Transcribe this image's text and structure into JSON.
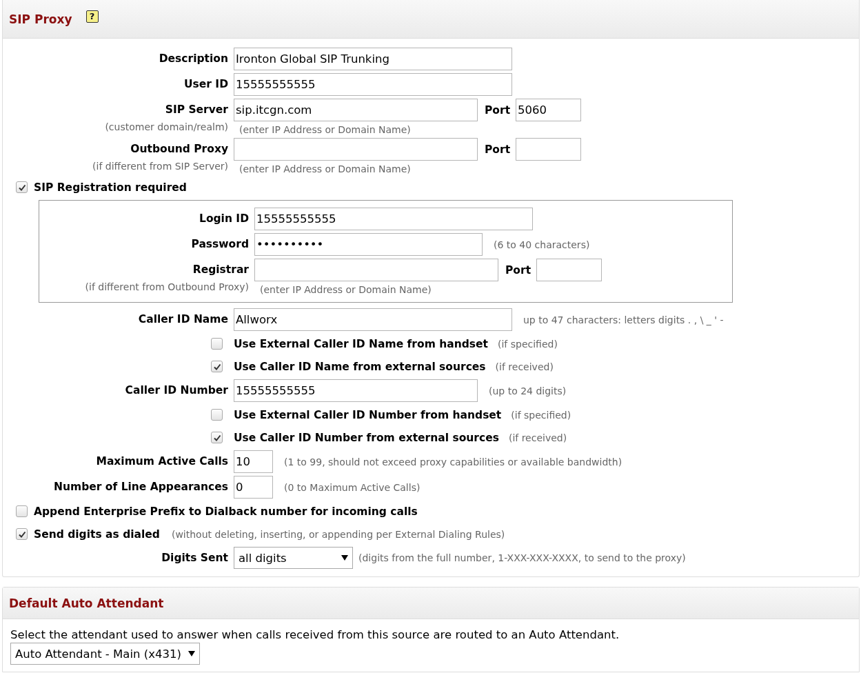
{
  "sections": [
    {
      "title": "SIP Proxy",
      "help": "?",
      "rows": [
        {
          "kind": "field",
          "label": "Description",
          "value": "Ironton Global SIP Trunking"
        },
        {
          "kind": "field",
          "label": "User ID",
          "value": "15555555555"
        },
        {
          "kind": "field",
          "label": "SIP Server",
          "sublabel": "(customer domain/realm)",
          "value": "sip.itcgn.com",
          "port": {
            "label": "Port",
            "value": "5060"
          },
          "hint": "(enter IP Address or Domain Name)"
        },
        {
          "kind": "field",
          "label": "Outbound Proxy",
          "sublabel": "(if different from SIP Server)",
          "port": {
            "label": "Port"
          },
          "hint": "(enter IP Address or Domain Name)"
        },
        {
          "kind": "check",
          "label": "SIP Registration required",
          "checked": true
        },
        {
          "kind": "group",
          "rows": [
            {
              "kind": "field",
              "label": "Login ID",
              "value": "15555555555"
            },
            {
              "kind": "field",
              "label": "Password",
              "value": "••••••••••",
              "note": "(6 to 40 characters)"
            },
            {
              "kind": "field",
              "label": "Registrar",
              "sublabel": "(if different from Outbound Proxy)",
              "port": {
                "label": "Port"
              },
              "hint": "(enter IP Address or Domain Name)"
            }
          ]
        },
        {
          "kind": "field",
          "label": "Caller ID Name",
          "value": "Allworx",
          "note": "up to 47 characters: letters digits . , \\ _ ' -"
        },
        {
          "kind": "option",
          "label": "Use External Caller ID Name from handset",
          "note": "(if specified)",
          "checked": false
        },
        {
          "kind": "option",
          "label": "Use Caller ID Name from external sources",
          "note": "(if received)",
          "checked": true
        },
        {
          "kind": "field",
          "label": "Caller ID Number",
          "value": "15555555555",
          "note": "(up to 24 digits)"
        },
        {
          "kind": "option",
          "label": "Use External Caller ID Number from handset",
          "note": "(if specified)",
          "checked": false
        },
        {
          "kind": "option",
          "label": "Use Caller ID Number from external sources",
          "note": "(if received)",
          "checked": true
        },
        {
          "kind": "field",
          "label": "Maximum Active Calls",
          "value": "10",
          "note": "(1 to 99, should not exceed proxy capabilities or available bandwidth)"
        },
        {
          "kind": "field",
          "label": "Number of Line Appearances",
          "value": "0",
          "note": "(0 to Maximum Active Calls)"
        },
        {
          "kind": "check",
          "label": "Append Enterprise Prefix to Dialback number for incoming calls",
          "checked": false
        },
        {
          "kind": "check",
          "label": "Send digits as dialed",
          "note": "(without deleting, inserting, or appending per External Dialing Rules)",
          "checked": true
        },
        {
          "kind": "select",
          "label": "Digits Sent",
          "value": "all digits",
          "note": "(digits from the full number, 1-XXX-XXX-XXXX, to send to the proxy)"
        }
      ]
    },
    {
      "title": "Default Auto Attendant",
      "rows": [
        {
          "kind": "text",
          "text": "Select the attendant used to answer when calls received from this source are routed to an Auto Attendant."
        },
        {
          "kind": "select",
          "value": "Auto Attendant - Main (x431)"
        }
      ]
    }
  ]
}
